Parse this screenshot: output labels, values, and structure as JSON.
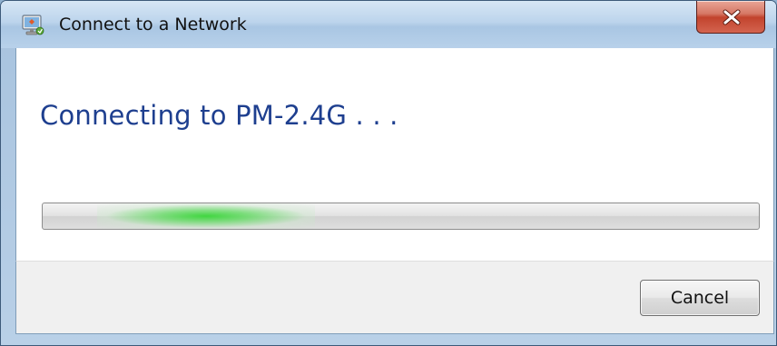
{
  "window": {
    "title": "Connect to a Network",
    "icon": "network-connect-icon"
  },
  "main": {
    "heading": "Connecting to PM-2.4G . . ."
  },
  "progress": {
    "mode": "indeterminate",
    "glow_color": "#40d640"
  },
  "footer": {
    "cancel_label": "Cancel"
  },
  "colors": {
    "heading": "#1e3f8f",
    "close_button": "#c2432d",
    "titlebar": "#bcd4ec"
  }
}
